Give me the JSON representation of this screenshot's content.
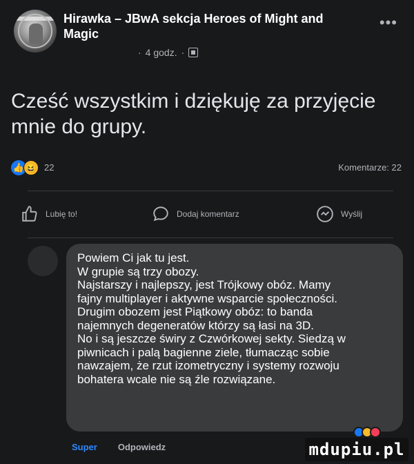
{
  "group": {
    "title": "Hirawka – JBwA sekcja Heroes of Might and Magic",
    "time": "4 godz.",
    "separator": "·"
  },
  "post": {
    "text": "Cześć wszystkim i dziękuję za przyjęcie mnie do grupy."
  },
  "stats": {
    "reaction_count": "22",
    "comments": "Komentarze: 22"
  },
  "actions": {
    "like": "Lubię to!",
    "comment": "Dodaj komentarz",
    "share": "Wyślij"
  },
  "comment": {
    "lines": [
      "Powiem Ci jak tu jest.",
      "W grupie są trzy obozy.",
      "Najstarszy i najlepszy, jest Trójkowy obóz. Mamy",
      "fajny multiplayer i aktywne wsparcie społeczności.",
      "Drugim obozem jest Piątkowy obóz: to banda",
      "najemnych degeneratów którzy są łasi na 3D.",
      "No i są jeszcze świry z Czwórkowej sekty. Siedzą w",
      "piwnicach i palą bagienne ziele, tłumacząc sobie",
      "nawzajem, że rzut izometryczny i systemy rozwoju",
      "bohatera wcale nie są źle rozwiązane."
    ],
    "like_label": "Super",
    "reply_label": "Odpowiedz"
  },
  "watermark": "mdupiu.pl",
  "colors": {
    "background": "#18191b",
    "bubble": "#3a3b3c",
    "like_blue": "#2d88ff"
  },
  "icons": [
    "more-icon",
    "globe-icon",
    "like-reaction-icon",
    "haha-reaction-icon",
    "thumbs-up-icon",
    "comment-icon",
    "share-icon"
  ]
}
